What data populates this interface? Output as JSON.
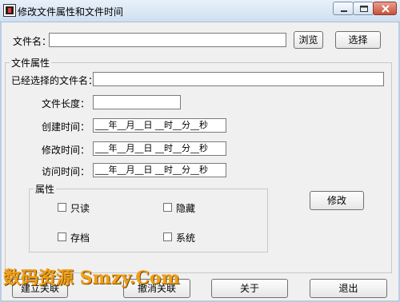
{
  "window": {
    "title": "修改文件属性和文件时间"
  },
  "file": {
    "label": "文件名：",
    "value": "",
    "browse_label": "浏览",
    "select_label": "选择"
  },
  "attrs_group": {
    "title": "文件属性",
    "selected_label": "已经选择的文件名：",
    "selected_value": "",
    "length_label": "文件长度：",
    "length_value": "",
    "created_label": "创建时间：",
    "modified_label": "修改时间：",
    "accessed_label": "访问时间：",
    "date_template": "___年__月__日 __时__分__秒"
  },
  "props_group": {
    "title": "属性",
    "readonly_label": "只读",
    "hidden_label": "隐藏",
    "archive_label": "存档",
    "system_label": "系统"
  },
  "modify_button": "修改",
  "bottom_buttons": {
    "associate": "建立关联",
    "unassociate": "撤消关联",
    "about": "关于",
    "exit": "退出"
  },
  "watermark": "数码资源 Smzy.Com",
  "colors": {
    "titlebar": "#cfdff0",
    "frame": "#b9cde3",
    "watermark": "#f0a018"
  }
}
